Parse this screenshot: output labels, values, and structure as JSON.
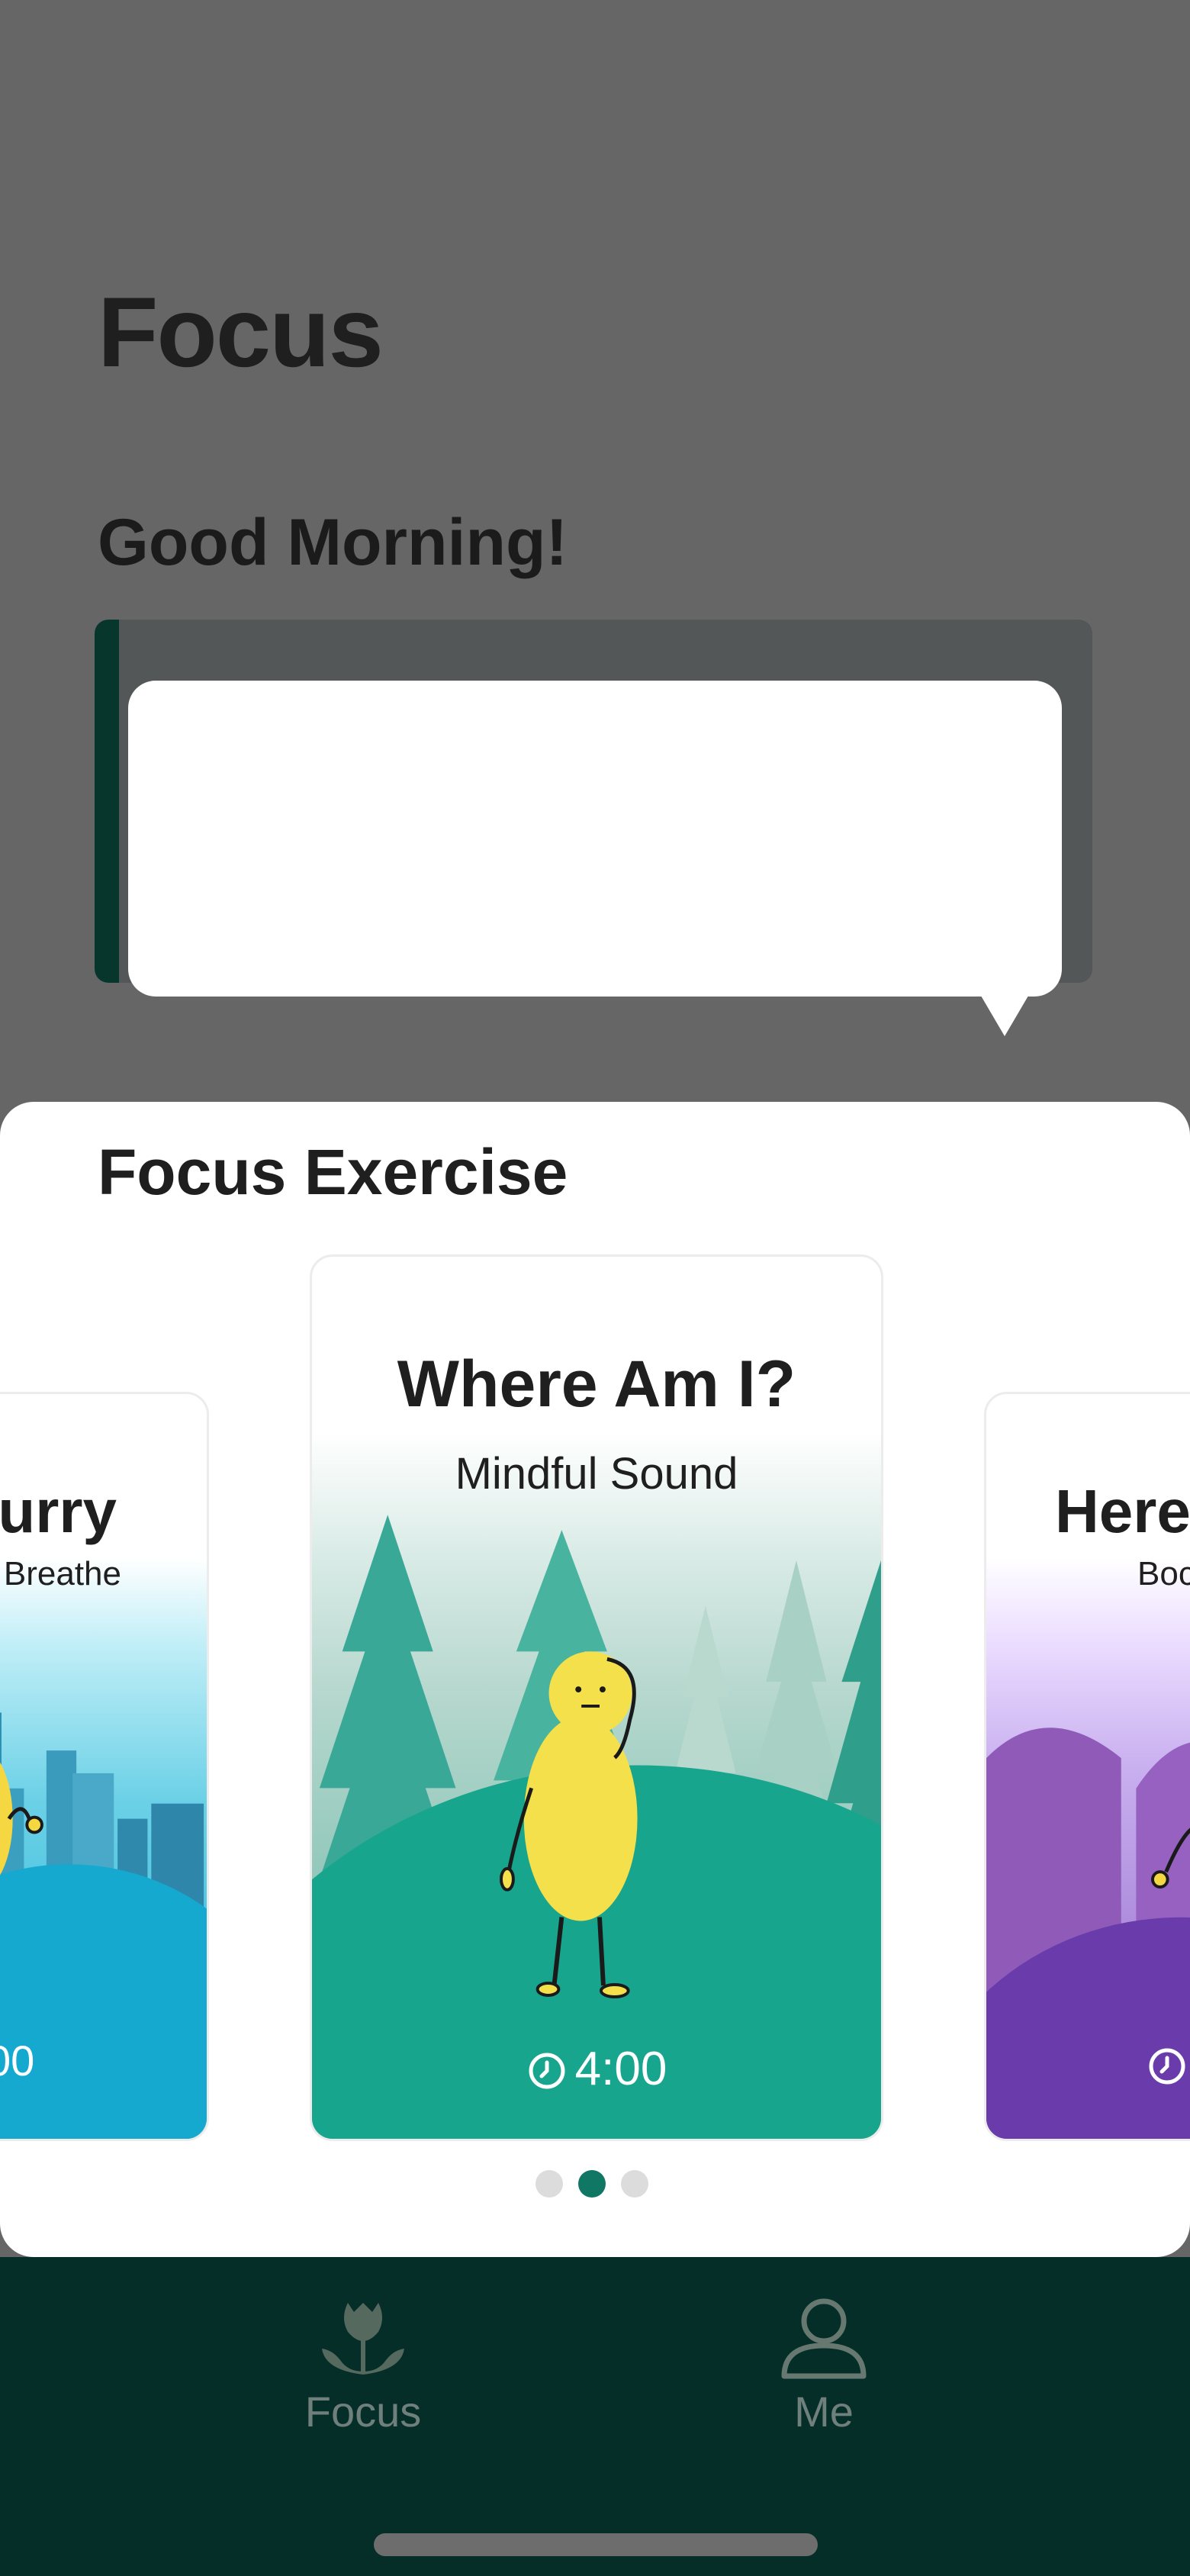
{
  "header": {
    "title": "Focus",
    "greeting": "Good Morning!"
  },
  "sheet": {
    "title": "Focus Exercise",
    "cards": [
      {
        "title": "urry",
        "subtitle": "Breathe",
        "duration": "00",
        "theme": "#1fb2d8"
      },
      {
        "title": "Where Am I?",
        "subtitle": "Mindful Sound",
        "duration": "4:00",
        "theme": "#17a58e"
      },
      {
        "title": "Here",
        "subtitle": "Boc",
        "duration": "",
        "theme": "#6d3fb0"
      }
    ],
    "pagination": {
      "total": 3,
      "active_index": 2
    }
  },
  "nav": {
    "items": [
      {
        "label": "Focus",
        "icon": "tulip-icon"
      },
      {
        "label": "Me",
        "icon": "person-icon"
      }
    ]
  },
  "colors": {
    "accent": "#0f7764",
    "nav_background": "#062e29",
    "overlay": "#666666"
  }
}
